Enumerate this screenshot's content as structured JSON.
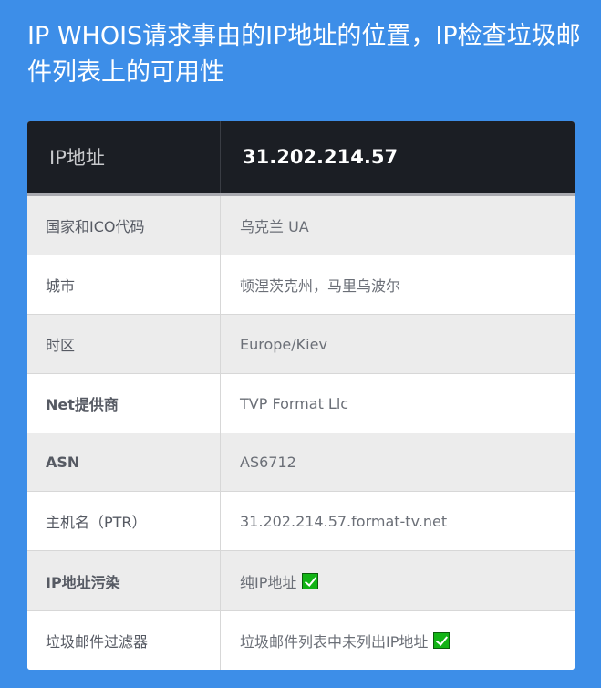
{
  "title": "IP WHOIS请求事由的IP地址的位置，IP检查垃圾邮件列表上的可用性",
  "table": {
    "header": {
      "label": "IP地址",
      "value": "31.202.214.57"
    },
    "rows": [
      {
        "label": "国家和ICO代码",
        "value": "乌克兰 UA"
      },
      {
        "label": "城市",
        "value": "顿涅茨克州，马里乌波尔"
      },
      {
        "label": "时区",
        "value": "Europe/Kiev"
      },
      {
        "label": "Net提供商",
        "value": "TVP Format Llc"
      },
      {
        "label": "ASN",
        "value": "AS6712"
      },
      {
        "label": "主机名（PTR）",
        "value": "31.202.214.57.format-tv.net"
      },
      {
        "label": "IP地址污染",
        "value": "纯IP地址",
        "icon": "check-icon"
      },
      {
        "label": "垃圾邮件过滤器",
        "value": "垃圾邮件列表中未列出IP地址",
        "icon": "check-icon"
      }
    ]
  },
  "colors": {
    "page_background": "#3d8ee8",
    "header_background": "#1b1e24",
    "check_green": "#12b315"
  }
}
